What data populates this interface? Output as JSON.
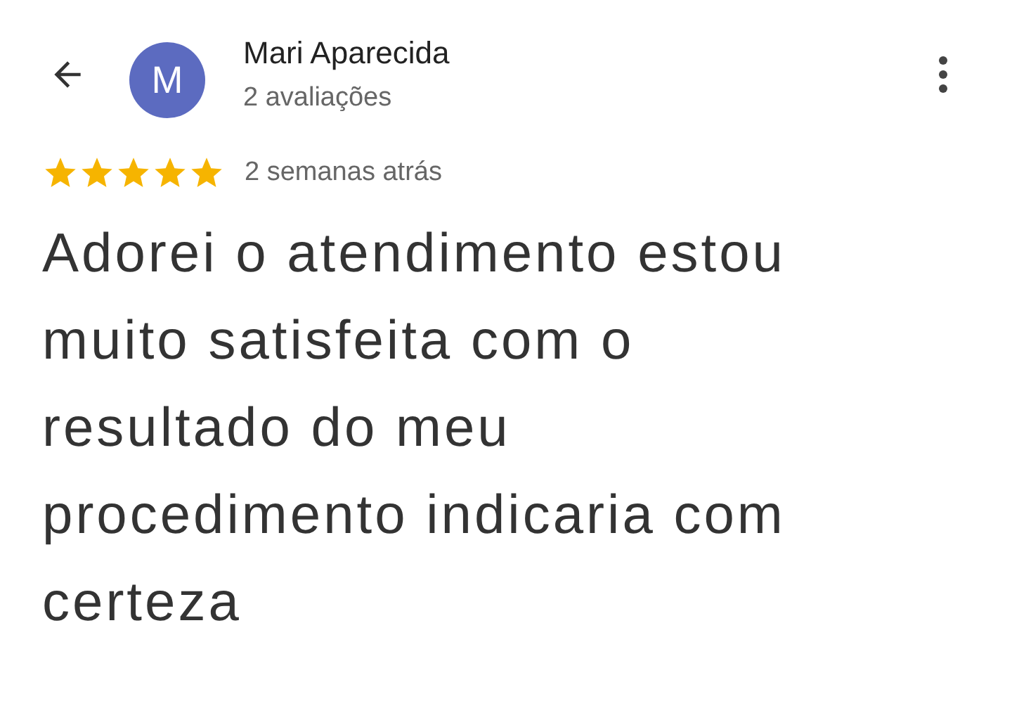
{
  "header": {
    "avatar_letter": "M",
    "name": "Mari Aparecida",
    "subtitle": "2 avaliações"
  },
  "review": {
    "stars": 5,
    "time": "2 semanas atrás",
    "text": "Adorei o atendimento estou muito satisfeita com o resultado do meu procedimento indicaria com certeza"
  }
}
